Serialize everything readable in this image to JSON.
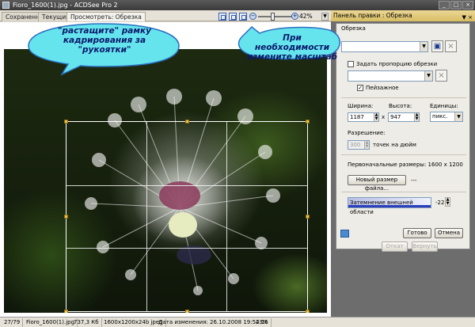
{
  "window": {
    "title": "Fioro_1600(1).jpg - ACDSee Pro 2"
  },
  "tabs": [
    {
      "label": "Сохраненное"
    },
    {
      "label": "Текущий"
    },
    {
      "label": "Просмотреть: Обрезка"
    }
  ],
  "toolbar": {
    "zoom_value": "42%",
    "zoom_minus": "−",
    "zoom_plus": "+"
  },
  "panel": {
    "title": "Панель правки : Обрезка",
    "section_label": "Обрезка",
    "ratio_checkbox_label": "Задать пропорцию обрезки",
    "landscape_label": "Пейзажное",
    "width_label": "Ширина:",
    "height_label": "Высота:",
    "units_label": "Единицы:",
    "width_value": "1187",
    "height_value": "947",
    "units_value": "пикс.",
    "times": "x",
    "resolution_label": "Разрешение:",
    "resolution_value": "300",
    "resolution_unit": "точек на дюйм",
    "original_size_label": "Первоначальные размеры: 1600 x 1200",
    "new_size_button": "Новый размер файла...",
    "new_size_value": "---",
    "dim_outside_label": "Затемнение внешней области",
    "dim_outside_value": "-22",
    "ok_button": "Готово",
    "cancel_button": "Отмена",
    "undo_button": "Откат",
    "redo_button": "Вернуть"
  },
  "callouts": {
    "left": "\"растащите\" рамку кадрирования за \"рукоятки\"",
    "right": "При необходимости измените масштаб"
  },
  "statusbar": {
    "index": "27/79",
    "filename": "Fioro_1600(1).jpg",
    "filesize": "737,3 Кб",
    "dimensions": "1600x1200x24b jpeg",
    "modified": "Дата изменения: 26.10.2008 19:52:16",
    "zoom": "43%"
  },
  "colors": {
    "panel_header": "#e0c572",
    "callout_fill": "#66e4ee",
    "crop_handle": "#f0c24a",
    "dim_slider_bar": "#2b3fbd"
  }
}
